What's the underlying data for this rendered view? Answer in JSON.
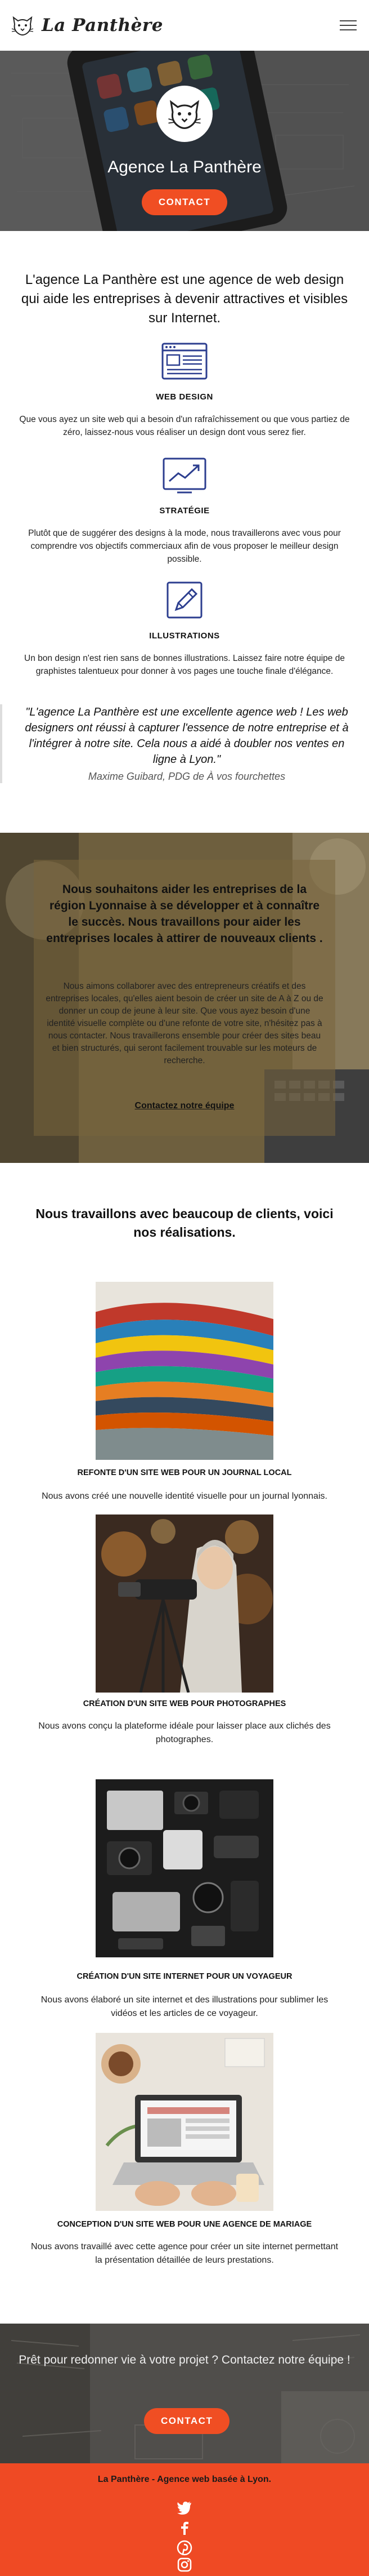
{
  "header": {
    "logo_text": "La Panthère",
    "logo_icon": "panther-head-icon",
    "menu_icon": "hamburger-menu-icon"
  },
  "hero": {
    "title": "Agence La Panthère",
    "cta_label": "CONTACT"
  },
  "intro": {
    "text": "L'agence La Panthère est une agence de web design qui aide les entreprises à devenir attractives et visibles sur Internet."
  },
  "services": [
    {
      "icon": "browser-window-icon",
      "title": "WEB DESIGN",
      "text": "Que vous ayez un site web qui a besoin d'un rafraîchissement ou que vous partiez de zéro, laissez-nous vous réaliser un design dont vous serez fier."
    },
    {
      "icon": "trend-chart-icon",
      "title": "STRATÉGIE",
      "text": "Plutôt que de suggérer des designs à la mode, nous travaillerons avec vous pour comprendre vos objectifs commerciaux afin de vous proposer le meilleur design possible."
    },
    {
      "icon": "pencil-icon",
      "title": "ILLUSTRATIONS",
      "text": "Un bon design n'est rien sans de bonnes illustrations. Laissez faire notre équipe de graphistes talentueux pour donner à vos pages une touche finale d'élégance."
    }
  ],
  "quote": {
    "text": "\"L'agence La Panthère est une excellente agence web ! Les web designers ont réussi à capturer l'essence de notre entreprise et à l'intégrer à notre site. Cela nous a aidé à doubler nos ventes en ligne à Lyon.\"",
    "author": "Maxime Guibard, PDG de À vos fourchettes"
  },
  "mission": {
    "title": "Nous souhaitons aider les entreprises de la région Lyonnaise à se développer et à connaître le succès. Nous travaillons pour aider les entreprises locales à attirer de nouveaux clients .",
    "text": "Nous aimons collaborer avec des entrepreneurs créatifs et des entreprises locales, qu'elles aient besoin de créer un site de A à Z ou de donner un coup de jeune à leur site. Que vous ayez besoin d'une identité visuelle complète ou d'une refonte de votre site, n'hésitez pas à nous contacter. Nous travaillerons ensemble pour créer des sites beau et bien structurés, qui seront facilement trouvable sur les moteurs de recherche.",
    "link_label": "Contactez notre équipe"
  },
  "portfolio": {
    "heading": "Nous travaillons avec beaucoup de clients, voici nos réalisations.",
    "projects": [
      {
        "title": "REFONTE D'UN SITE WEB POUR UN JOURNAL LOCAL",
        "text": "Nous avons créé une nouvelle identité visuelle pour un journal lyonnais."
      },
      {
        "title": "CRÉATION D'UN SITE WEB POUR PHOTOGRAPHES",
        "text": "Nous avons conçu la plateforme idéale pour laisser place aux clichés des photographes."
      },
      {
        "title": "CRÉATION D'UN SITE INTERNET POUR UN VOYAGEUR",
        "text": "Nous avons élaboré un site internet et des illustrations pour sublimer les vidéos et les articles de ce voyageur."
      },
      {
        "title": "CONCEPTION D'UN SITE WEB POUR UNE AGENCE DE MARIAGE",
        "text": "Nous avons travaillé avec cette agence pour créer un site internet permettant la présentation détaillée de leurs prestations."
      }
    ]
  },
  "cta": {
    "text": "Prêt pour redonner vie à votre projet ? Contactez notre équipe !",
    "button_label": "CONTACT"
  },
  "footer": {
    "text": "La Panthère - Agence web basée à Lyon.",
    "social_icons": [
      "twitter-icon",
      "facebook-icon",
      "pinterest-icon",
      "instagram-icon"
    ]
  },
  "colors": {
    "accent": "#f04e23",
    "footer": "#ef4a24",
    "text": "#222222"
  }
}
